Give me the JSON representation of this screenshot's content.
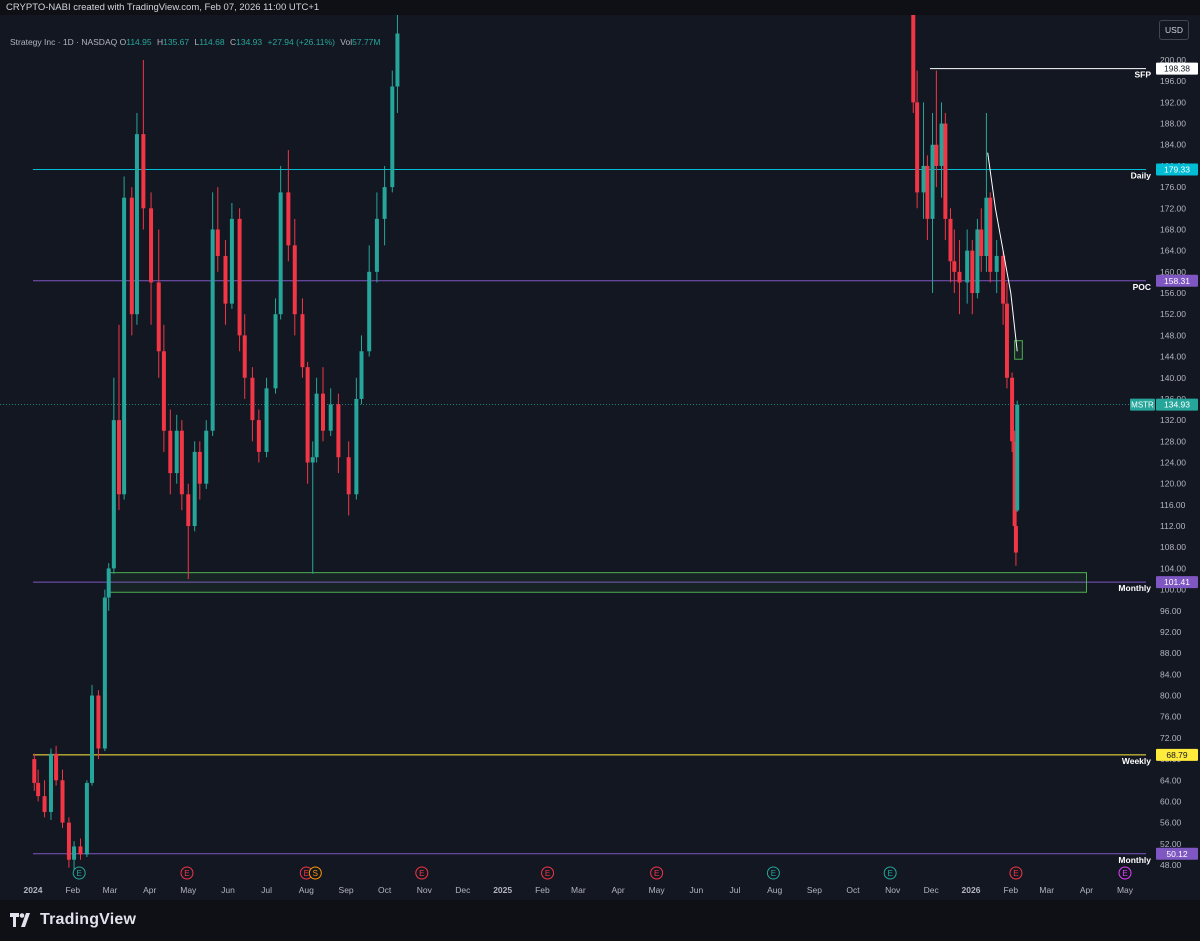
{
  "credit": "CRYPTO-NABI created with TradingView.com, Feb 07, 2026 11:00 UTC+1",
  "footer": {
    "logo_text": "TradingView"
  },
  "currency_button": "USD",
  "legend": {
    "symbol": "Strategy Inc · 1D · NASDAQ",
    "o_label": "O",
    "o": "114.95",
    "h_label": "H",
    "h": "135.67",
    "l_label": "L",
    "l": "114.68",
    "c_label": "C",
    "c": "134.93",
    "change": "+27.94 (+26.11%)",
    "vol_label": "Vol",
    "vol": "57.77M"
  },
  "colors": {
    "background": "#131722",
    "up": "#26a69a",
    "down": "#f23645",
    "daily": "#00bcd4",
    "poc": "#7e57c2",
    "weekly": "#ffeb3b",
    "zone": "#4caf50"
  },
  "chart_data": {
    "type": "candlestick",
    "symbol": "MSTR",
    "timeframe": "1D",
    "ylim": [
      45,
      205
    ],
    "y_ticks": [
      "48.00",
      "52.00",
      "56.00",
      "60.00",
      "64.00",
      "68.00",
      "72.00",
      "76.00",
      "80.00",
      "84.00",
      "88.00",
      "92.00",
      "96.00",
      "100.00",
      "104.00",
      "108.00",
      "112.00",
      "116.00",
      "120.00",
      "124.00",
      "128.00",
      "132.00",
      "136.00",
      "140.00",
      "144.00",
      "148.00",
      "152.00",
      "156.00",
      "160.00",
      "164.00",
      "168.00",
      "172.00",
      "176.00",
      "180.00",
      "184.00",
      "188.00",
      "192.00",
      "196.00",
      "200.00"
    ],
    "x_ticks": [
      "2024",
      "Feb",
      "Mar",
      "Apr",
      "May",
      "Jun",
      "Jul",
      "Aug",
      "Sep",
      "Oct",
      "Nov",
      "Dec",
      "2025",
      "Feb",
      "Mar",
      "Apr",
      "May",
      "Jun",
      "Jul",
      "Aug",
      "Sep",
      "Oct",
      "Nov",
      "Dec",
      "2026",
      "Feb",
      "Mar",
      "Apr",
      "May"
    ],
    "x_tick_dates": [
      "2024-01-01",
      "2024-02-01",
      "2024-03-01",
      "2024-04-01",
      "2024-05-01",
      "2024-06-01",
      "2024-07-01",
      "2024-08-01",
      "2024-09-01",
      "2024-10-01",
      "2024-11-01",
      "2024-12-01",
      "2025-01-01",
      "2025-02-01",
      "2025-03-01",
      "2025-04-01",
      "2025-05-01",
      "2025-06-01",
      "2025-07-01",
      "2025-08-01",
      "2025-09-01",
      "2025-10-01",
      "2025-11-01",
      "2025-12-01",
      "2026-01-01",
      "2026-02-01",
      "2026-03-01",
      "2026-04-01",
      "2026-05-01"
    ],
    "levels": [
      {
        "label": "SFP",
        "value": 198.38,
        "price_label": "198.38",
        "color": "#ffffff",
        "start_date": "2025-11-30"
      },
      {
        "label": "Daily",
        "value": 179.33,
        "price_label": "179.33",
        "color": "#00bcd4",
        "start_date": "2024-01-01"
      },
      {
        "label": "POC",
        "value": 158.31,
        "price_label": "158.31",
        "color": "#7e57c2",
        "start_date": "2024-01-01"
      },
      {
        "label": "Monthly",
        "value": 101.41,
        "price_label": "101.41",
        "color": "#7e57c2",
        "start_date": "2024-01-01"
      },
      {
        "label": "Weekly",
        "value": 68.79,
        "price_label": "68.79",
        "color": "#ffeb3b",
        "start_date": "2024-01-01"
      },
      {
        "label": "Monthly",
        "value": 50.12,
        "price_label": "50.12",
        "color": "#7e57c2",
        "start_date": "2024-01-01"
      }
    ],
    "current_price": {
      "label": "MSTR",
      "value": 134.93,
      "price_label": "134.93"
    },
    "zones": [
      {
        "from_date": "2024-03-01",
        "to_date": "2026-04-01",
        "low": 99.5,
        "high": 103.2,
        "color": "#4caf50"
      },
      {
        "from_date": "2026-02-04",
        "to_date": "2026-02-10",
        "low": 143.5,
        "high": 147.0,
        "color": "#4caf50"
      }
    ],
    "trend_line": [
      {
        "date": "2026-01-14",
        "value": 182.5
      },
      {
        "date": "2026-01-20",
        "value": 172.0
      },
      {
        "date": "2026-01-26",
        "value": 164.0
      },
      {
        "date": "2026-02-01",
        "value": 156.0
      },
      {
        "date": "2026-02-06",
        "value": 145.0
      }
    ],
    "events": [
      {
        "date": "2024-02-06",
        "type": "E",
        "color": "#26a69a"
      },
      {
        "date": "2024-04-30",
        "type": "E",
        "color": "#f23645"
      },
      {
        "date": "2024-08-01",
        "type": "E",
        "color": "#f23645"
      },
      {
        "date": "2024-08-08",
        "type": "S",
        "color": "#ff9800"
      },
      {
        "date": "2024-10-30",
        "type": "E",
        "color": "#f23645"
      },
      {
        "date": "2025-02-05",
        "type": "E",
        "color": "#f23645"
      },
      {
        "date": "2025-05-01",
        "type": "E",
        "color": "#f23645"
      },
      {
        "date": "2025-07-31",
        "type": "E",
        "color": "#26a69a"
      },
      {
        "date": "2025-10-30",
        "type": "E",
        "color": "#26a69a"
      },
      {
        "date": "2026-02-05",
        "type": "E",
        "color": "#f23645"
      },
      {
        "date": "2026-05-01",
        "type": "E",
        "color": "#e040fb"
      }
    ],
    "candles": [
      [
        "2024-01-02",
        68.0,
        69.0,
        62.0,
        63.5
      ],
      [
        "2024-01-05",
        63.5,
        66.0,
        60.0,
        61.0
      ],
      [
        "2024-01-10",
        61.0,
        64.0,
        57.0,
        58.0
      ],
      [
        "2024-01-15",
        58.0,
        70.0,
        56.5,
        69.0
      ],
      [
        "2024-01-19",
        69.0,
        70.5,
        63.0,
        64.0
      ],
      [
        "2024-01-24",
        64.0,
        66.0,
        55.0,
        56.0
      ],
      [
        "2024-01-29",
        56.0,
        57.0,
        47.5,
        49.0
      ],
      [
        "2024-02-02",
        49.0,
        52.5,
        47.0,
        51.5
      ],
      [
        "2024-02-07",
        51.5,
        53.0,
        49.0,
        50.0
      ],
      [
        "2024-02-12",
        50.0,
        64.0,
        49.5,
        63.5
      ],
      [
        "2024-02-16",
        63.5,
        82.0,
        63.0,
        80.0
      ],
      [
        "2024-02-21",
        80.0,
        81.0,
        68.0,
        70.0
      ],
      [
        "2024-02-26",
        70.0,
        100.0,
        69.5,
        98.5
      ],
      [
        "2024-02-29",
        98.5,
        105.0,
        96.0,
        104.0
      ],
      [
        "2024-03-04",
        104.0,
        140.0,
        103.0,
        132.0
      ],
      [
        "2024-03-08",
        132.0,
        150.0,
        115.0,
        118.0
      ],
      [
        "2024-03-12",
        118.0,
        178.0,
        117.0,
        174.0
      ],
      [
        "2024-03-18",
        174.0,
        176.0,
        148.0,
        152.0
      ],
      [
        "2024-03-22",
        152.0,
        190.0,
        150.0,
        186.0
      ],
      [
        "2024-03-27",
        186.0,
        200.0,
        168.0,
        172.0
      ],
      [
        "2024-04-02",
        172.0,
        175.0,
        150.0,
        158.0
      ],
      [
        "2024-04-08",
        158.0,
        168.0,
        140.0,
        145.0
      ],
      [
        "2024-04-12",
        145.0,
        150.0,
        126.0,
        130.0
      ],
      [
        "2024-04-17",
        130.0,
        134.0,
        118.0,
        122.0
      ],
      [
        "2024-04-22",
        122.0,
        133.0,
        120.0,
        130.0
      ],
      [
        "2024-04-26",
        130.0,
        132.0,
        115.0,
        118.0
      ],
      [
        "2024-05-01",
        118.0,
        120.0,
        102.0,
        112.0
      ],
      [
        "2024-05-06",
        112.0,
        128.0,
        111.0,
        126.0
      ],
      [
        "2024-05-10",
        126.0,
        128.0,
        117.0,
        120.0
      ],
      [
        "2024-05-15",
        120.0,
        132.0,
        119.0,
        130.0
      ],
      [
        "2024-05-20",
        130.0,
        175.0,
        129.0,
        168.0
      ],
      [
        "2024-05-24",
        168.0,
        176.0,
        160.0,
        163.0
      ],
      [
        "2024-05-30",
        163.0,
        166.0,
        150.0,
        154.0
      ],
      [
        "2024-06-04",
        154.0,
        173.0,
        153.0,
        170.0
      ],
      [
        "2024-06-10",
        170.0,
        172.0,
        145.0,
        148.0
      ],
      [
        "2024-06-14",
        148.0,
        152.0,
        136.0,
        140.0
      ],
      [
        "2024-06-20",
        140.0,
        142.0,
        128.0,
        132.0
      ],
      [
        "2024-06-25",
        132.0,
        134.0,
        124.0,
        126.0
      ],
      [
        "2024-07-01",
        126.0,
        140.0,
        125.0,
        138.0
      ],
      [
        "2024-07-08",
        138.0,
        155.0,
        137.0,
        152.0
      ],
      [
        "2024-07-12",
        152.0,
        180.0,
        151.0,
        175.0
      ],
      [
        "2024-07-18",
        175.0,
        183.0,
        162.0,
        165.0
      ],
      [
        "2024-07-23",
        165.0,
        170.0,
        148.0,
        152.0
      ],
      [
        "2024-07-29",
        152.0,
        155.0,
        140.0,
        142.0
      ],
      [
        "2024-08-02",
        142.0,
        143.0,
        120.0,
        124.0
      ],
      [
        "2024-08-06",
        124.0,
        128.0,
        103.0,
        125.0
      ],
      [
        "2024-08-09",
        125.0,
        140.0,
        124.0,
        137.0
      ],
      [
        "2024-08-14",
        137.0,
        142.0,
        128.0,
        130.0
      ],
      [
        "2024-08-20",
        130.0,
        138.0,
        129.0,
        135.0
      ],
      [
        "2024-08-26",
        135.0,
        137.0,
        122.0,
        125.0
      ],
      [
        "2024-09-03",
        125.0,
        128.0,
        114.0,
        118.0
      ],
      [
        "2024-09-09",
        118.0,
        140.0,
        117.0,
        136.0
      ],
      [
        "2024-09-13",
        136.0,
        148.0,
        135.0,
        145.0
      ],
      [
        "2024-09-19",
        145.0,
        165.0,
        144.0,
        160.0
      ],
      [
        "2024-09-25",
        160.0,
        175.0,
        158.0,
        170.0
      ],
      [
        "2024-10-01",
        170.0,
        180.0,
        165.0,
        176.0
      ],
      [
        "2024-10-07",
        176.0,
        198.0,
        175.0,
        195.0
      ],
      [
        "2024-10-11",
        195.0,
        210.0,
        190.0,
        205.0
      ]
    ],
    "candles_late": [
      [
        "2025-11-17",
        210.0,
        212.0,
        190.0,
        192.0
      ],
      [
        "2025-11-20",
        192.0,
        198.0,
        172.0,
        175.0
      ],
      [
        "2025-11-25",
        175.0,
        192.0,
        170.0,
        180.0
      ],
      [
        "2025-11-28",
        180.0,
        182.0,
        166.0,
        170.0
      ],
      [
        "2025-12-02",
        170.0,
        190.0,
        156.0,
        184.0
      ],
      [
        "2025-12-05",
        184.0,
        198.0,
        176.0,
        180.0
      ],
      [
        "2025-12-09",
        180.0,
        192.0,
        174.0,
        188.0
      ],
      [
        "2025-12-12",
        188.0,
        190.0,
        166.0,
        170.0
      ],
      [
        "2025-12-16",
        170.0,
        172.0,
        158.0,
        162.0
      ],
      [
        "2025-12-19",
        162.0,
        168.0,
        156.0,
        160.0
      ],
      [
        "2025-12-23",
        160.0,
        166.0,
        152.0,
        158.0
      ],
      [
        "2025-12-29",
        158.0,
        168.0,
        154.0,
        164.0
      ],
      [
        "2026-01-02",
        164.0,
        166.0,
        152.0,
        156.0
      ],
      [
        "2026-01-06",
        156.0,
        170.0,
        155.0,
        168.0
      ],
      [
        "2026-01-09",
        168.0,
        172.0,
        160.0,
        163.0
      ],
      [
        "2026-01-13",
        163.0,
        190.0,
        160.0,
        174.0
      ],
      [
        "2026-01-16",
        174.0,
        175.0,
        158.0,
        160.0
      ],
      [
        "2026-01-21",
        160.0,
        166.0,
        156.0,
        163.0
      ],
      [
        "2026-01-26",
        163.0,
        164.0,
        150.0,
        154.0
      ],
      [
        "2026-01-29",
        154.0,
        158.0,
        138.0,
        140.0
      ],
      [
        "2026-02-02",
        140.0,
        141.0,
        126.0,
        128.0
      ],
      [
        "2026-02-04",
        128.0,
        130.0,
        110.0,
        112.0
      ],
      [
        "2026-02-05",
        112.0,
        113.0,
        104.5,
        107.0
      ],
      [
        "2026-02-06",
        114.95,
        135.67,
        114.68,
        134.93
      ]
    ]
  }
}
